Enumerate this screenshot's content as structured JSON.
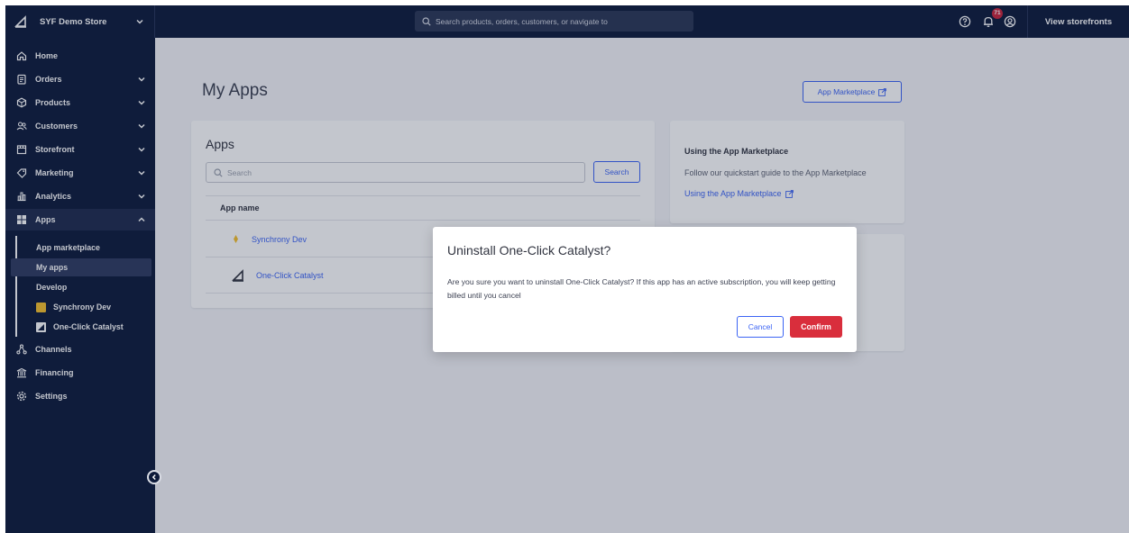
{
  "topbar": {
    "store_name": "SYF Demo Store",
    "search_placeholder": "Search products, orders, customers, or navigate to",
    "notification_count": "71",
    "view_storefronts": "View storefronts"
  },
  "sidebar": {
    "items": [
      {
        "label": "Home",
        "icon": "home-icon"
      },
      {
        "label": "Orders",
        "icon": "orders-icon"
      },
      {
        "label": "Products",
        "icon": "products-icon"
      },
      {
        "label": "Customers",
        "icon": "customers-icon"
      },
      {
        "label": "Storefront",
        "icon": "storefront-icon"
      },
      {
        "label": "Marketing",
        "icon": "marketing-icon"
      },
      {
        "label": "Analytics",
        "icon": "analytics-icon"
      },
      {
        "label": "Apps",
        "icon": "apps-icon"
      },
      {
        "label": "Channels",
        "icon": "channels-icon"
      },
      {
        "label": "Financing",
        "icon": "financing-icon"
      },
      {
        "label": "Settings",
        "icon": "settings-icon"
      }
    ],
    "apps_sub": {
      "app_marketplace": "App marketplace",
      "my_apps": "My apps",
      "develop": "Develop",
      "synchrony_dev": "Synchrony Dev",
      "one_click_catalyst": "One-Click Catalyst"
    }
  },
  "main": {
    "page_title": "My Apps",
    "marketplace_button": "App Marketplace",
    "apps_card": {
      "title": "Apps",
      "search_placeholder": "Search",
      "search_button": "Search",
      "column_header": "App name",
      "rows": [
        "Synchrony Dev",
        "One-Click Catalyst"
      ]
    },
    "guide_card": {
      "title": "Using the App Marketplace",
      "text": "Follow our quickstart guide to the App Marketplace",
      "link": "Using the App Marketplace"
    }
  },
  "modal": {
    "title": "Uninstall One-Click Catalyst?",
    "body": "Are you sure you want to uninstall One-Click Catalyst? If this app has an active subscription, you will keep getting billed until you cancel",
    "cancel": "Cancel",
    "confirm": "Confirm"
  },
  "colors": {
    "navy": "#0d1a3a",
    "accent_blue": "#3c64f4",
    "confirm_red": "#d92e3c",
    "badge_red": "#c9243a"
  }
}
